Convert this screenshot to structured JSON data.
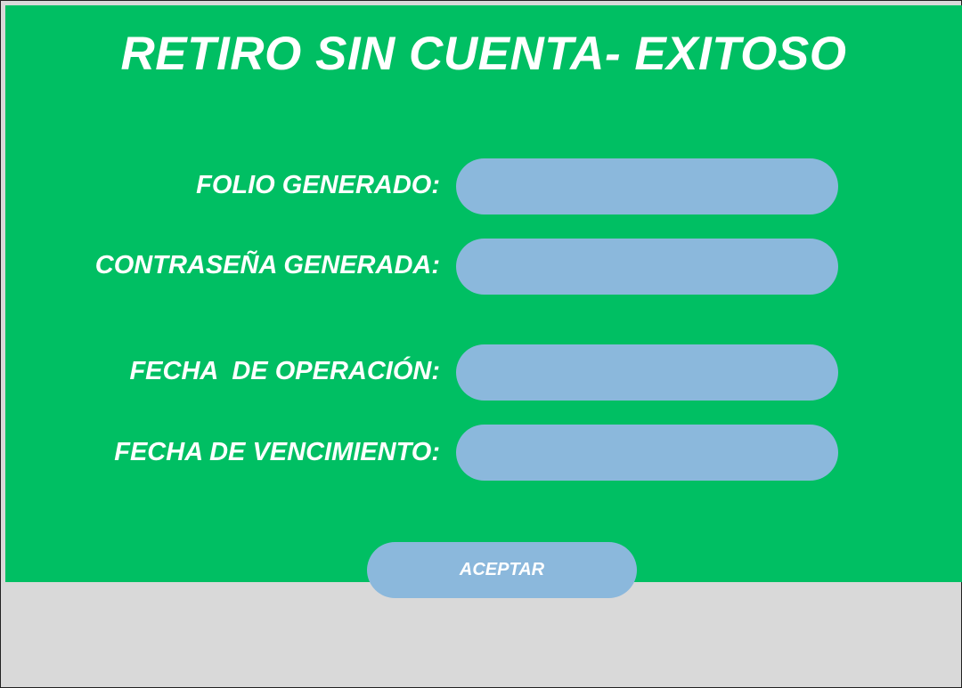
{
  "title": "RETIRO SIN CUENTA- EXITOSO",
  "fields": {
    "folio": {
      "label": "FOLIO GENERADO:",
      "value": ""
    },
    "password": {
      "label": "CONTRASEÑA GENERADA:",
      "value": ""
    },
    "operation_date": {
      "label": "FECHA  DE OPERACIÓN:",
      "value": ""
    },
    "expiry_date": {
      "label": "FECHA DE VENCIMIENTO:",
      "value": ""
    }
  },
  "accept_label": "ACEPTAR",
  "colors": {
    "panel": "#00bf63",
    "field": "#8bb8dc",
    "background": "#d9d9d9",
    "text": "#ffffff"
  }
}
